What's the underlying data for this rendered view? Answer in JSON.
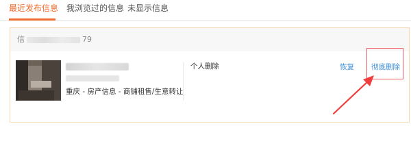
{
  "tabs": [
    {
      "label": "最近发布信息",
      "active": true
    },
    {
      "label": "我浏览过的信息",
      "active": false
    },
    {
      "label": "未显示信息",
      "active": false
    }
  ],
  "post": {
    "masked_id_prefix": "信",
    "masked_id_suffix": "79",
    "category": "重庆 - 房产信息 - 商铺租售/生意转让",
    "status": "个人删除",
    "restore_label": "恢复",
    "delete_label": "彻底删除"
  },
  "colors": {
    "accent": "#f06a2b",
    "link": "#3a8ed8",
    "highlight": "#f05a64",
    "card_border": "#f4d9b4"
  },
  "annotation": {
    "arrow_icon": "red-arrow-icon",
    "box_icon": "red-highlight-box"
  }
}
